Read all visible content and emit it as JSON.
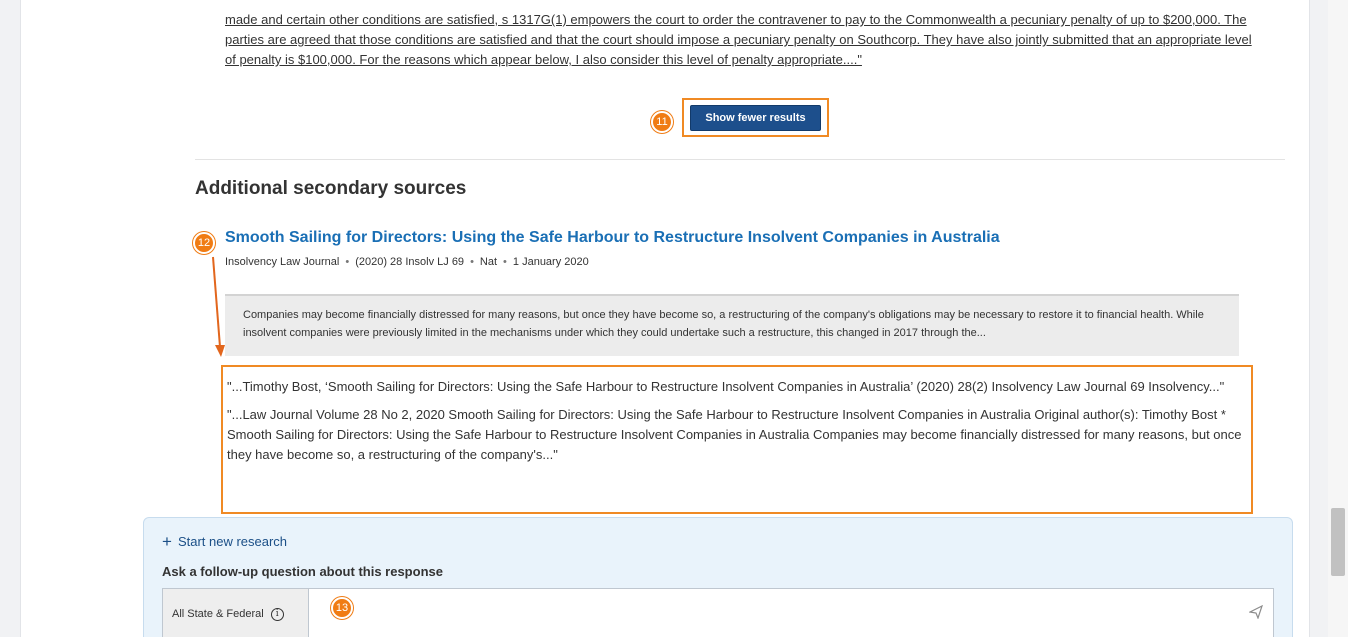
{
  "content": {
    "top_excerpt": "made and certain other conditions are satisfied, s 1317G(1) empowers the court to order the contravener to pay to the Commonwealth a pecuniary penalty of up to $200,000. The parties are agreed that those conditions are satisfied and that the court should impose a pecuniary penalty on Southcorp. They have also jointly submitted that an appropriate level of penalty is $100,000. For the reasons which appear below, I also consider this level of penalty appropriate....\"",
    "show_fewer_label": "Show fewer results"
  },
  "badges": {
    "b11": "11",
    "b12": "12",
    "b13": "13"
  },
  "secondary": {
    "heading": "Additional secondary sources",
    "result": {
      "title": "Smooth Sailing for Directors: Using the Safe Harbour to Restructure Insolvent Companies in Australia",
      "meta": [
        "Insolvency Law Journal",
        "(2020) 28 Insolv LJ 69",
        "Nat",
        "1 January 2020"
      ],
      "summary": "Companies may become financially distressed for many reasons, but once they have become so, a restructuring of the company's obligations may be necessary to restore it to financial health. While insolvent companies were previously limited in the mechanisms under which they could undertake such a restructure, this changed in 2017 through the...",
      "excerpts": [
        "\"...Timothy Bost, ‘Smooth Sailing for Directors: Using the Safe Harbour to Restructure Insolvent Companies in Australia’ (2020) 28(2) Insolvency Law Journal 69 Insolvency...\"",
        "\"...Law Journal Volume 28 No 2, 2020 Smooth Sailing for Directors: Using the Safe Harbour to Restructure Insolvent Companies in Australia Original author(s): Timothy Bost * Smooth Sailing for Directors: Using the Safe Harbour to Restructure Insolvent Companies in Australia Companies may become financially distressed for many reasons, but once they have become so, a restructuring of the company's...\""
      ]
    }
  },
  "followup": {
    "start_new": "Start new research",
    "ask_label": "Ask a follow-up question about this response",
    "jurisdiction": "All State & Federal",
    "input_value": "",
    "placeholder": ""
  },
  "icons": {
    "plus": "plus-icon",
    "info": "info-icon",
    "send": "send-icon"
  },
  "colors": {
    "accent_orange": "#f08a24",
    "button_blue": "#1d4f8c",
    "link_blue": "#1a6fb5"
  }
}
